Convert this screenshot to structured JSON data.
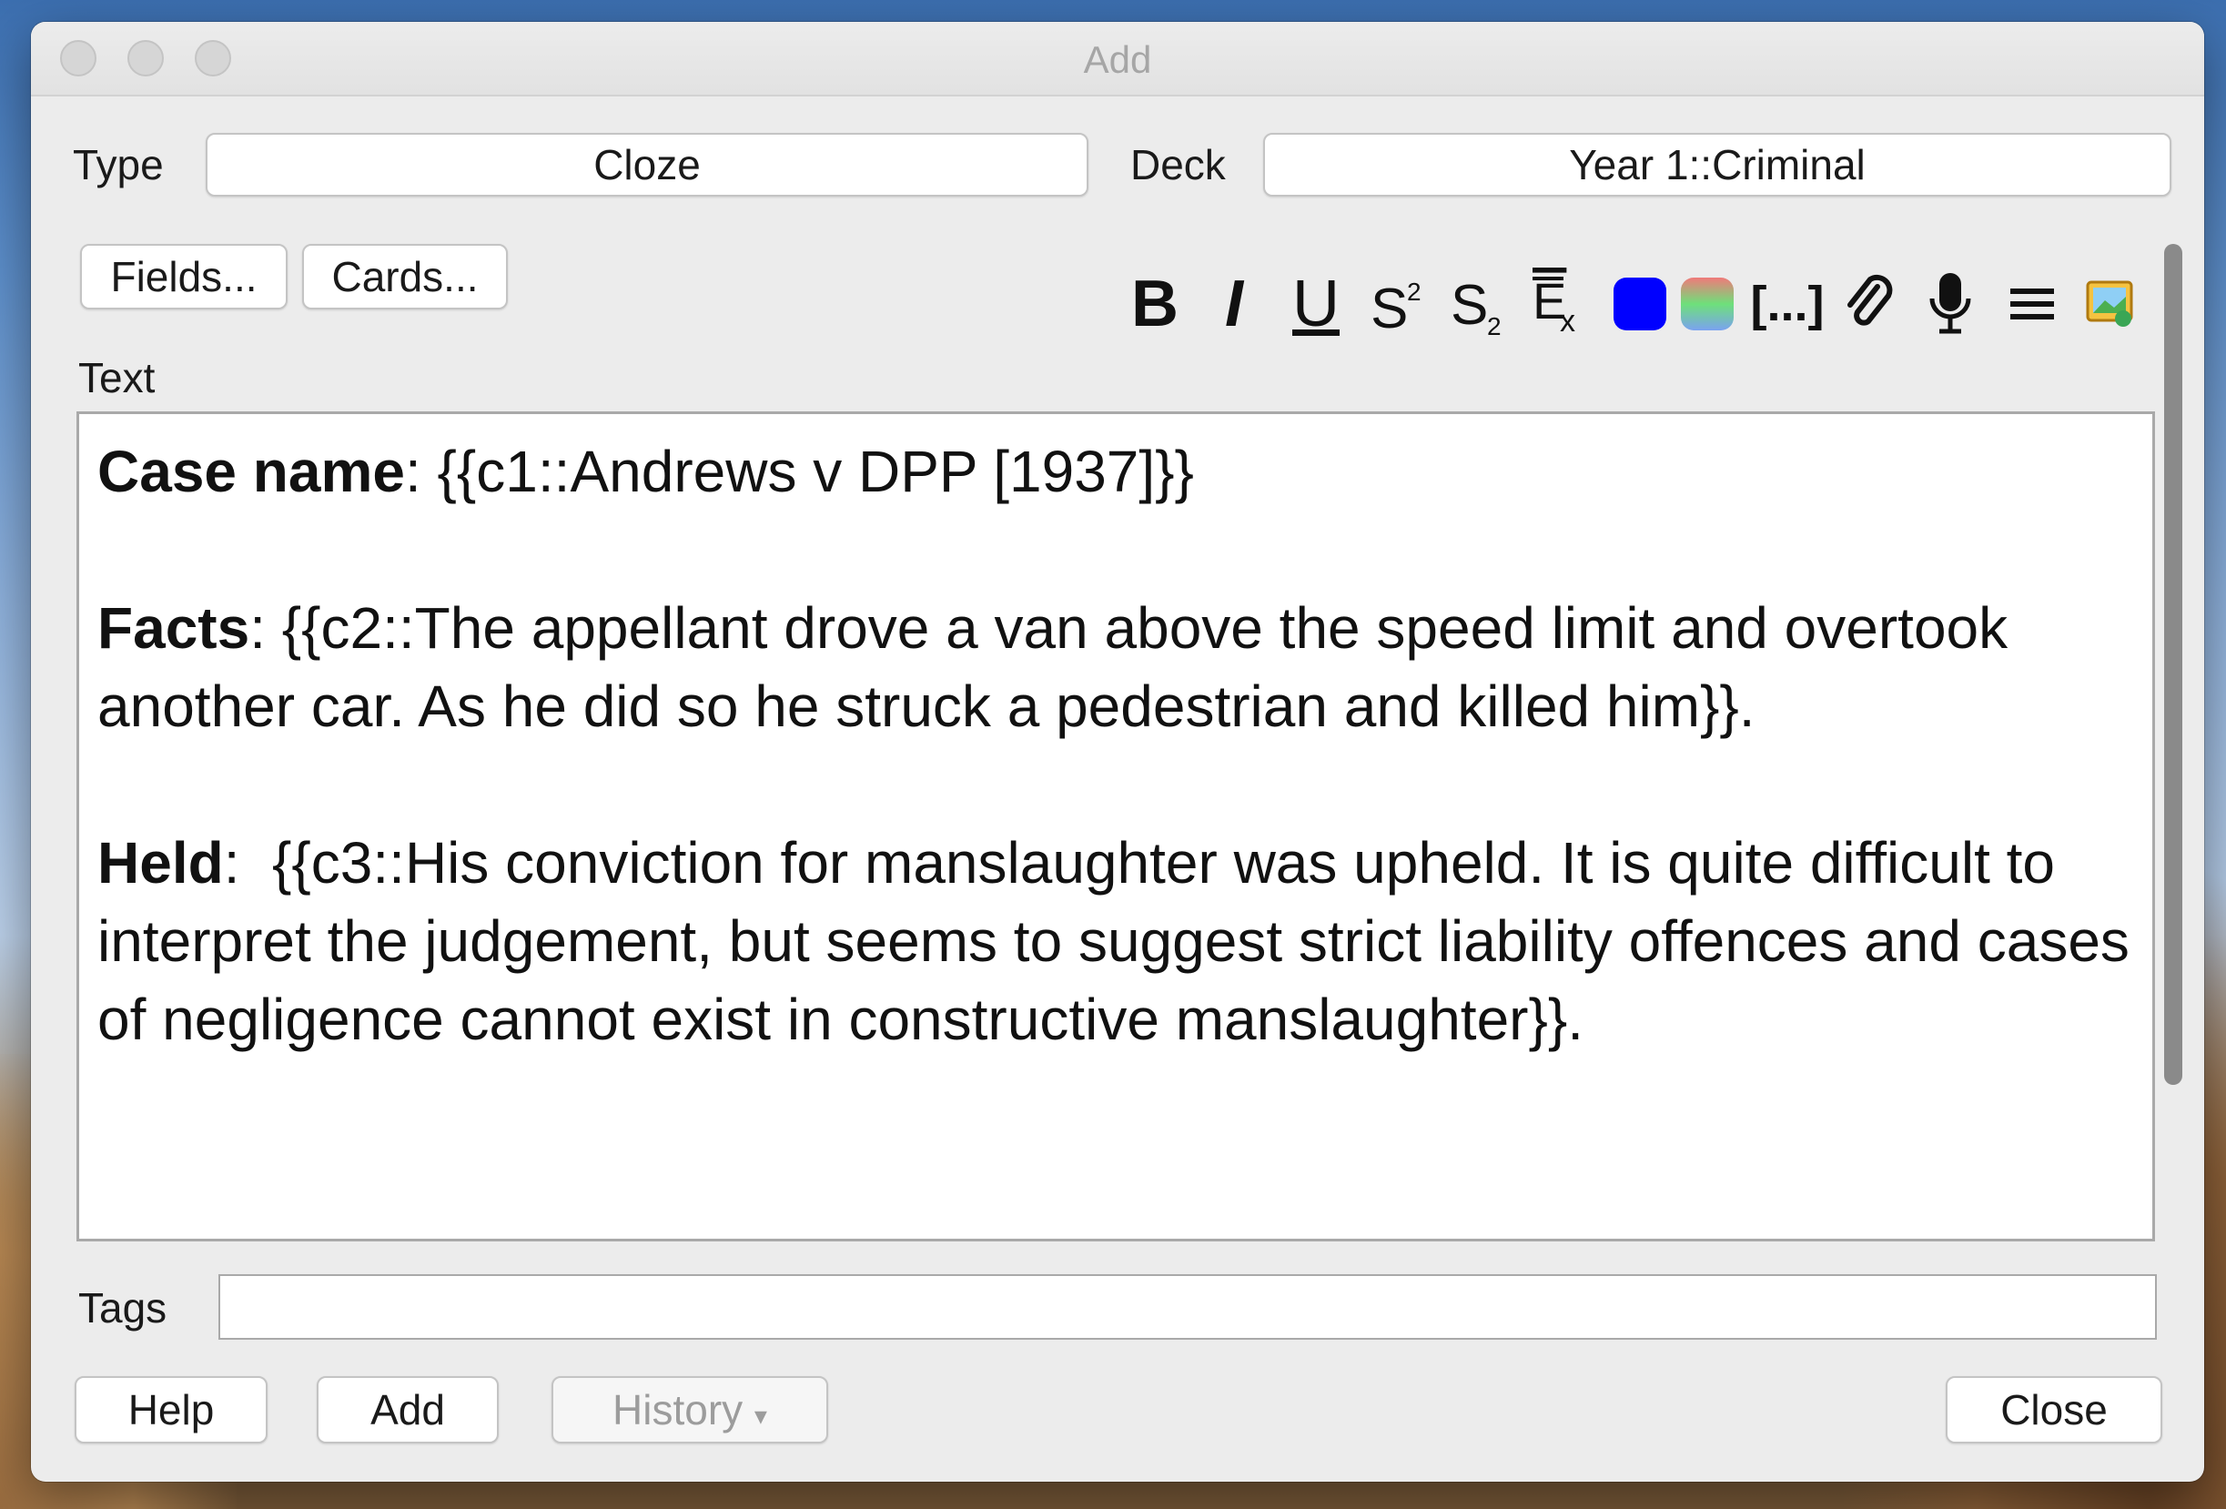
{
  "window": {
    "title": "Add"
  },
  "type_row": {
    "type_label": "Type",
    "type_value": "Cloze",
    "deck_label": "Deck",
    "deck_value": "Year 1::Criminal"
  },
  "buttons": {
    "fields": "Fields...",
    "cards": "Cards...",
    "help": "Help",
    "add": "Add",
    "history": "History",
    "history_arrow": "▾",
    "close": "Close"
  },
  "toolbar": {
    "bold": "B",
    "italic": "I",
    "underline": "U",
    "cloze": "[...]",
    "text_color": "#0000ff",
    "icons": [
      "bold-icon",
      "italic-icon",
      "underline-icon",
      "superscript-icon",
      "subscript-icon",
      "clear-format-icon",
      "text-color-icon",
      "highlight-color-icon",
      "cloze-icon",
      "attach-icon",
      "microphone-icon",
      "menu-icon",
      "image-icon"
    ]
  },
  "field": {
    "name": "Text",
    "case_label": "Case name",
    "case_value": ": {{c1::Andrews v DPP [1937]}}",
    "facts_label": "Facts",
    "facts_value": ": {{c2::The appellant drove a van above the speed limit and overtook another car. As he did so he struck a pedestrian and killed him}}.",
    "held_label": "Held",
    "held_value": ":  {{c3::His conviction for manslaughter was upheld. It is quite difficult to interpret the judgement, but seems to suggest strict liability offences and cases of negligence cannot exist in constructive manslaughter}}."
  },
  "tags": {
    "label": "Tags",
    "value": ""
  }
}
